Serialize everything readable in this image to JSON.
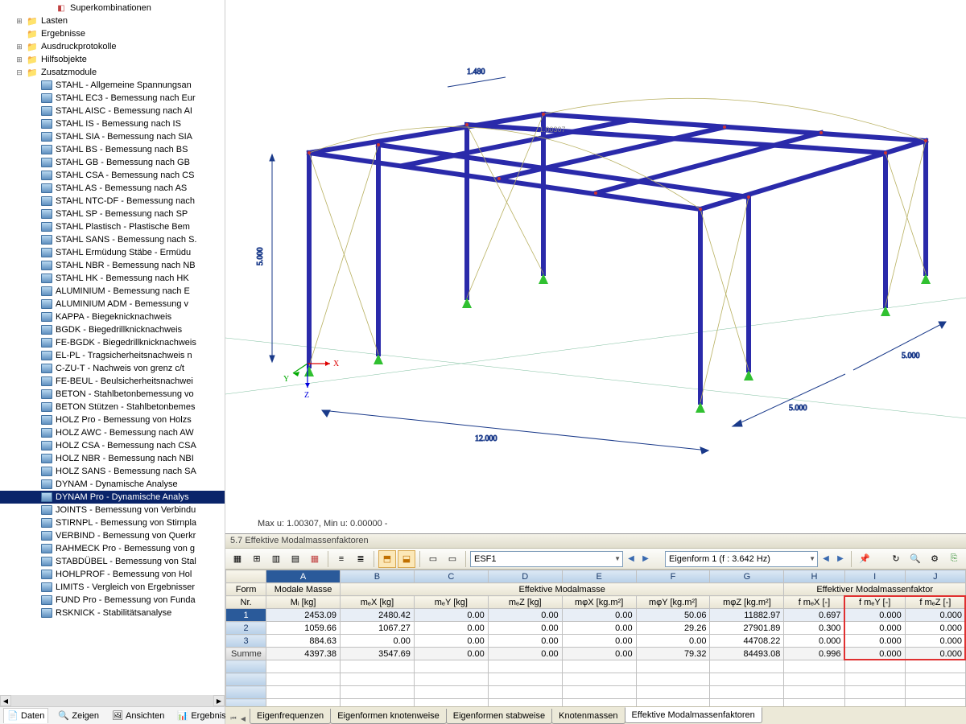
{
  "sidebar": {
    "top_items": [
      {
        "label": "Superkombinationen",
        "indent": 3,
        "icon": "combo"
      },
      {
        "label": "Lasten",
        "indent": 1,
        "icon": "folder",
        "exp": "+"
      },
      {
        "label": "Ergebnisse",
        "indent": 1,
        "icon": "folder"
      },
      {
        "label": "Ausdruckprotokolle",
        "indent": 1,
        "icon": "folder",
        "exp": "+"
      },
      {
        "label": "Hilfsobjekte",
        "indent": 1,
        "icon": "folder",
        "exp": "+"
      },
      {
        "label": "Zusatzmodule",
        "indent": 1,
        "icon": "folder",
        "exp": "-"
      }
    ],
    "modules": [
      "STAHL - Allgemeine Spannungsan",
      "STAHL EC3 - Bemessung nach Eur",
      "STAHL AISC - Bemessung nach AI",
      "STAHL IS - Bemessung nach IS",
      "STAHL SIA - Bemessung nach SIA",
      "STAHL BS - Bemessung nach BS",
      "STAHL GB - Bemessung nach GB",
      "STAHL CSA - Bemessung nach CS",
      "STAHL AS - Bemessung nach AS",
      "STAHL NTC-DF - Bemessung nach",
      "STAHL SP - Bemessung nach SP",
      "STAHL Plastisch - Plastische Bem",
      "STAHL SANS - Bemessung nach S.",
      "STAHL Ermüdung Stäbe - Ermüdu",
      "STAHL NBR - Bemessung nach NB",
      "STAHL HK - Bemessung nach HK",
      "ALUMINIUM - Bemessung nach E",
      "ALUMINIUM ADM - Bemessung v",
      "KAPPA - Biegeknicknachweis",
      "BGDK - Biegedrillknicknachweis",
      "FE-BGDK - Biegedrillknicknachweis",
      "EL-PL - Tragsicherheitsnachweis n",
      "C-ZU-T - Nachweis von grenz c/t",
      "FE-BEUL - Beulsicherheitsnachwei",
      "BETON - Stahlbetonbemessung vo",
      "BETON Stützen - Stahlbetonbemes",
      "HOLZ Pro - Bemessung von Holzs",
      "HOLZ AWC - Bemessung nach AW",
      "HOLZ CSA - Bemessung nach CSA",
      "HOLZ NBR - Bemessung nach NBI",
      "HOLZ SANS - Bemessung nach SA",
      "DYNAM - Dynamische Analyse",
      "DYNAM Pro - Dynamische Analys",
      "JOINTS - Bemessung von Verbindu",
      "STIRNPL - Bemessung von Stirnpla",
      "VERBIND - Bemessung von Querkr",
      "RAHMECK Pro - Bemessung von g",
      "STABDÜBEL - Bemessung von Stal",
      "HOHLPROF - Bemessung von Hol",
      "LIMITS - Vergleich von Ergebnisser",
      "FUND Pro - Bemessung von Funda",
      "RSKNICK - Stabilitätsanalyse"
    ],
    "selected_index": 32,
    "tabs": [
      {
        "label": "Daten",
        "icon": "📄"
      },
      {
        "label": "Zeigen",
        "icon": "🔍"
      },
      {
        "label": "Ansichten",
        "icon": "🖼"
      },
      {
        "label": "Ergebnis...",
        "icon": "📊"
      }
    ]
  },
  "viewport": {
    "dims": {
      "length": "12.000",
      "width1": "5.000",
      "width2": "5.000",
      "height": "5.000",
      "top": "1.480"
    },
    "deform": "1.00307",
    "status": "Max u: 1.00307, Min u: 0.00000 -",
    "axes": {
      "x": "X",
      "y": "Y",
      "z": "Z"
    }
  },
  "panel": {
    "title": "5.7 Effektive Modalmassenfaktoren",
    "combo1": "ESF1",
    "combo2": "Eigenform 1 (f : 3.642 Hz)",
    "col_letters": [
      "A",
      "B",
      "C",
      "D",
      "E",
      "F",
      "G",
      "H",
      "I",
      "J"
    ],
    "group_headers": {
      "form": "Form",
      "mass": "Modale Masse",
      "eff_mass": "Effektive Modalmasse",
      "eff_factor": "Effektiver Modalmassenfaktor"
    },
    "sub_headers": {
      "nr": "Nr.",
      "mi": "Mᵢ [kg]",
      "mex": "mₑX [kg]",
      "mey": "mₑY [kg]",
      "mez": "mₑZ [kg]",
      "mphix": "mφX [kg.m²]",
      "mphiy": "mφY [kg.m²]",
      "mphiz": "mφZ [kg.m²]",
      "fmex": "f mₑX [-]",
      "fmey": "f mₑY [-]",
      "fmez": "f mₑZ [-]"
    },
    "rows": [
      {
        "nr": "1",
        "mi": "2453.09",
        "mex": "2480.42",
        "mey": "0.00",
        "mez": "0.00",
        "mphix": "0.00",
        "mphiy": "50.06",
        "mphiz": "11882.97",
        "fmex": "0.697",
        "fmey": "0.000",
        "fmez": "0.000",
        "sel": true
      },
      {
        "nr": "2",
        "mi": "1059.66",
        "mex": "1067.27",
        "mey": "0.00",
        "mez": "0.00",
        "mphix": "0.00",
        "mphiy": "29.26",
        "mphiz": "27901.89",
        "fmex": "0.300",
        "fmey": "0.000",
        "fmez": "0.000"
      },
      {
        "nr": "3",
        "mi": "884.63",
        "mex": "0.00",
        "mey": "0.00",
        "mez": "0.00",
        "mphix": "0.00",
        "mphiy": "0.00",
        "mphiz": "44708.22",
        "fmex": "0.000",
        "fmey": "0.000",
        "fmez": "0.000"
      }
    ],
    "sum": {
      "label": "Summe",
      "mi": "4397.38",
      "mex": "3547.69",
      "mey": "0.00",
      "mez": "0.00",
      "mphix": "0.00",
      "mphiy": "79.32",
      "mphiz": "84493.08",
      "fmex": "0.996",
      "fmey": "0.000",
      "fmez": "0.000"
    },
    "tabs": [
      "Eigenfrequenzen",
      "Eigenformen knotenweise",
      "Eigenformen stabweise",
      "Knotenmassen",
      "Effektive Modalmassenfaktoren"
    ],
    "active_tab": 4
  }
}
